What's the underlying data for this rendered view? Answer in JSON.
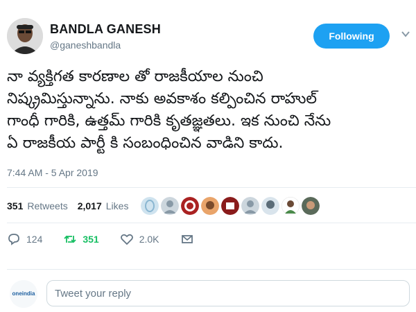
{
  "user": {
    "name": "BANDLA GANESH",
    "handle": "@ganeshbandla",
    "avatar_icon": "profile-photo"
  },
  "follow_button": {
    "label": "Following"
  },
  "menu_icon": "chevron-down-icon",
  "tweet": {
    "lines": [
      "నా వ్యక్తిగత కారణాల తో రాజకీయాల నుంచి",
      "నిష్క్రమిస్తున్నాను. నాకు అవకాశం కల్పించిన రాహుల్",
      "గాంధీ గారికి, ఉత్తమ్ గారికి కృతజ్ఞతలు. ఇక నుంచి నేను",
      "ఏ రాజకీయ పార్టీ కి సంబంధించిన వాడిని కాదు."
    ],
    "timestamp": "7:44 AM - 5 Apr 2019"
  },
  "stats": {
    "retweets_count": "351",
    "retweets_label": "Retweets",
    "likes_count": "2,017",
    "likes_label": "Likes"
  },
  "liker_avatars": [
    "liker-1",
    "liker-2",
    "liker-3",
    "liker-4",
    "liker-5",
    "liker-6",
    "liker-7",
    "liker-8",
    "liker-9",
    "liker-10",
    "liker-11"
  ],
  "actions": {
    "reply_count": "124",
    "retweet_count": "351",
    "like_count": "2.0K"
  },
  "reply": {
    "placeholder": "Tweet your reply",
    "logo_text": "oneindia"
  },
  "colors": {
    "accent": "#1da1f2",
    "retweet": "#17bf63",
    "muted": "#657786"
  }
}
